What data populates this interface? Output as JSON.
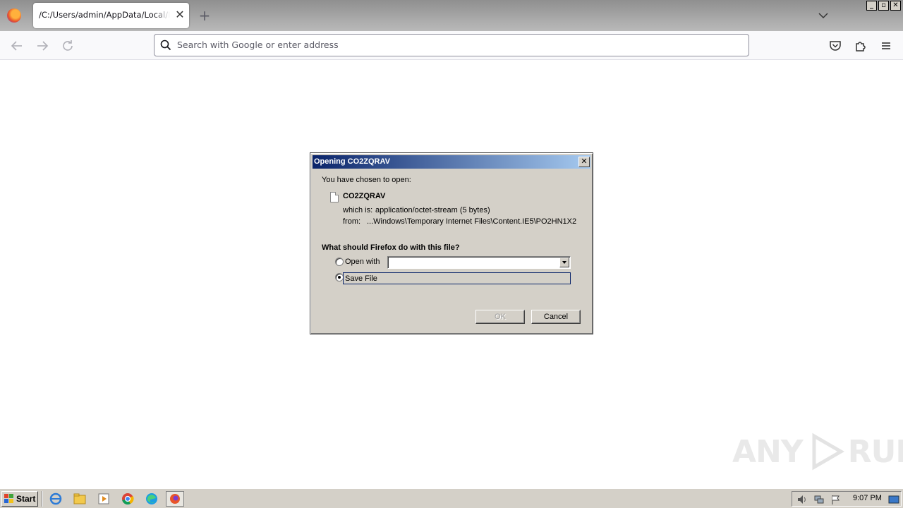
{
  "browser": {
    "tab_title": "/C:/Users/admin/AppData/Local/Microsoft/Windows/Temporary Internet Files/Content.IE5/PO2HN1X2/CO2ZQRAV",
    "tab_close": "✕",
    "new_tab": "+",
    "url_placeholder": "Search with Google or enter address",
    "window_buttons": {
      "minimize": "_",
      "maximize": "▫",
      "close": "✕"
    }
  },
  "dialog": {
    "title": "Opening CO2ZQRAV",
    "intro": "You have chosen to open:",
    "file_name": "CO2ZQRAV",
    "which_is_label": "which is:",
    "which_is_value": "application/octet-stream (5 bytes)",
    "from_label": "from:",
    "from_value": "...Windows\\Temporary Internet Files\\Content.IE5\\PO2HN1X2",
    "question": "What should Firefox do with this file?",
    "open_with_label": "Open with",
    "open_with_value": "",
    "save_file_label": "Save File",
    "selected_option": "save_file",
    "ok_label": "OK",
    "cancel_label": "Cancel",
    "close_glyph": "✕"
  },
  "watermark": {
    "text_left": "ANY",
    "text_right": "RUN"
  },
  "taskbar": {
    "start_label": "Start",
    "clock": "9:07 PM"
  },
  "colors": {
    "dialog_face": "#d4d0c8",
    "titlebar_start": "#0a246a",
    "titlebar_end": "#a6caf0",
    "taskbar": "#d4d0c8"
  }
}
